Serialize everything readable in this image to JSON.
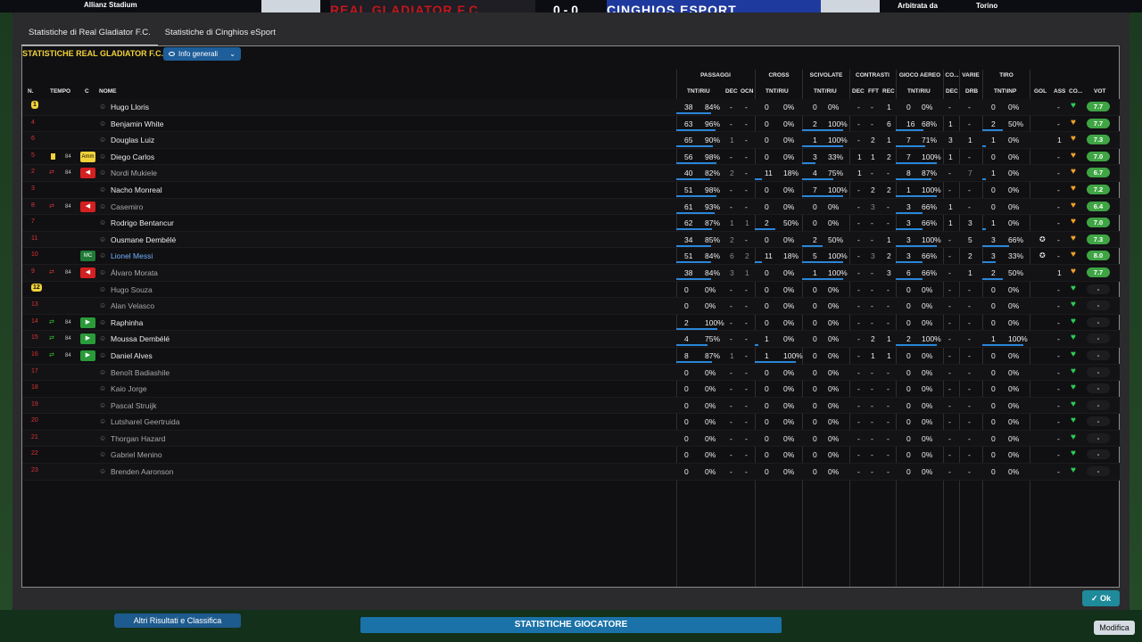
{
  "background": {
    "stadium": "Allianz Stadium",
    "referee_label": "Arbitrata da",
    "city": "Torino",
    "home_team": "REAL GLADIATOR F.C.",
    "away_team": "CINGHIOS ESPORT",
    "score": "0 - 0",
    "bottom_left_button": "Altri Risultati e Classifica",
    "bottom_mid_button": "STATISTICHE GIOCATORE",
    "bottom_right_button": "Modifica"
  },
  "tabs": [
    {
      "label": "Statistiche di Real Gladiator F.C."
    },
    {
      "label": "Statistiche di Cinghios eSport"
    }
  ],
  "panel": {
    "title": "STATISTICHE REAL GLADIATOR F.C.",
    "dropdown": "Info generali",
    "groups": {
      "passaggi": "PASSAGGI",
      "cross": "CROSS",
      "scivolate": "SCIVOLATE",
      "contrasti": "CONTRASTI",
      "gioco_aereo": "GIOCO AEREO",
      "co": "CO...",
      "varie": "VARIE",
      "tiro": "TIRO"
    },
    "columns": {
      "n": "N.",
      "tempo": "TEMPO",
      "c": "C",
      "nome": "NOME",
      "pass_tr": "TNT/RIU",
      "pass_dec": "DEC",
      "pass_ocn": "OCN",
      "cross_tr": "TNT/RIU",
      "sciv_tr": "TNT/RIU",
      "con_dec": "DEC",
      "con_fft": "FFT",
      "con_rec": "REC",
      "aereo_tr": "TNT/RIU",
      "co_dec": "DEC",
      "var_drb": "DRB",
      "tiro_ti": "TNT\\INP",
      "gol": "GOL",
      "ass": "ASS",
      "co2": "CO...",
      "vot": "VOT"
    }
  },
  "players": [
    {
      "n": "1",
      "tempo": "",
      "mins": "",
      "c": "",
      "name": "Hugo Lloris",
      "pass": [
        38,
        "84%"
      ],
      "dec": "-",
      "ocn": "-",
      "cross": [
        0,
        "0%"
      ],
      "sciv": [
        0,
        "0%"
      ],
      "cdec": "-",
      "fft": "-",
      "rec": "1",
      "aereo": [
        0,
        "0%"
      ],
      "codec": "-",
      "drb": "-",
      "tiro": [
        0,
        "0%"
      ],
      "gol": "",
      "ass": "-",
      "heart": "green",
      "vot": "7.7"
    },
    {
      "n": "4",
      "tempo": "",
      "mins": "",
      "c": "",
      "name": "Benjamin White",
      "pass": [
        63,
        "96%"
      ],
      "dec": "-",
      "ocn": "-",
      "cross": [
        0,
        "0%"
      ],
      "sciv": [
        2,
        "100%"
      ],
      "cdec": "-",
      "fft": "-",
      "rec": "6",
      "aereo": [
        16,
        "68%"
      ],
      "codec": "1",
      "drb": "-",
      "tiro": [
        2,
        "50%"
      ],
      "gol": "",
      "ass": "-",
      "heart": "orange",
      "vot": "7.7"
    },
    {
      "n": "6",
      "tempo": "",
      "mins": "",
      "c": "",
      "name": "Douglas Luiz",
      "pass": [
        65,
        "90%"
      ],
      "dec": "1",
      "ocn": "-",
      "cross": [
        0,
        "0%"
      ],
      "sciv": [
        1,
        "100%"
      ],
      "cdec": "-",
      "fft": "2",
      "rec": "1",
      "aereo": [
        7,
        "71%"
      ],
      "codec": "3",
      "drb": "1",
      "tiro": [
        1,
        "0%"
      ],
      "gol": "",
      "ass": "1",
      "heart": "orange",
      "vot": "7.3"
    },
    {
      "n": "5",
      "tempo": "card",
      "mins": "84",
      "c": "Amm",
      "name": "Diego Carlos",
      "pass": [
        56,
        "98%"
      ],
      "dec": "-",
      "ocn": "-",
      "cross": [
        0,
        "0%"
      ],
      "sciv": [
        3,
        "33%"
      ],
      "cdec": "1",
      "fft": "1",
      "rec": "2",
      "aereo": [
        7,
        "100%"
      ],
      "codec": "1",
      "drb": "-",
      "tiro": [
        0,
        "0%"
      ],
      "gol": "",
      "ass": "-",
      "heart": "orange",
      "vot": "7.0"
    },
    {
      "n": "2",
      "tempo": "out",
      "mins": "84",
      "c": "sub-out",
      "name": "Nordi Mukiele",
      "pass": [
        40,
        "82%"
      ],
      "dec": "2",
      "ocn": "-",
      "cross": [
        11,
        "18%"
      ],
      "sciv": [
        4,
        "75%"
      ],
      "cdec": "1",
      "fft": "-",
      "rec": "-",
      "aereo": [
        8,
        "87%"
      ],
      "codec": "-",
      "drb": "7",
      "tiro": [
        1,
        "0%"
      ],
      "gol": "",
      "ass": "-",
      "heart": "orange",
      "vot": "6.7"
    },
    {
      "n": "3",
      "tempo": "",
      "mins": "",
      "c": "",
      "name": "Nacho Monreal",
      "pass": [
        51,
        "98%"
      ],
      "dec": "-",
      "ocn": "-",
      "cross": [
        0,
        "0%"
      ],
      "sciv": [
        7,
        "100%"
      ],
      "cdec": "-",
      "fft": "2",
      "rec": "2",
      "aereo": [
        1,
        "100%"
      ],
      "codec": "-",
      "drb": "-",
      "tiro": [
        0,
        "0%"
      ],
      "gol": "",
      "ass": "-",
      "heart": "orange",
      "vot": "7.2"
    },
    {
      "n": "8",
      "tempo": "out",
      "mins": "84",
      "c": "sub-out",
      "name": "Casemiro",
      "pass": [
        61,
        "93%"
      ],
      "dec": "-",
      "ocn": "-",
      "cross": [
        0,
        "0%"
      ],
      "sciv": [
        0,
        "0%"
      ],
      "cdec": "-",
      "fft": "3",
      "rec": "-",
      "aereo": [
        3,
        "66%"
      ],
      "codec": "1",
      "drb": "-",
      "tiro": [
        0,
        "0%"
      ],
      "gol": "",
      "ass": "-",
      "heart": "orange",
      "vot": "6.4"
    },
    {
      "n": "7",
      "tempo": "",
      "mins": "",
      "c": "",
      "name": "Rodrigo Bentancur",
      "pass": [
        62,
        "87%"
      ],
      "dec": "1",
      "ocn": "1",
      "cross": [
        2,
        "50%"
      ],
      "sciv": [
        0,
        "0%"
      ],
      "cdec": "-",
      "fft": "-",
      "rec": "-",
      "aereo": [
        3,
        "66%"
      ],
      "codec": "1",
      "drb": "3",
      "tiro": [
        1,
        "0%"
      ],
      "gol": "",
      "ass": "-",
      "heart": "orange",
      "vot": "7.0"
    },
    {
      "n": "11",
      "tempo": "",
      "mins": "",
      "c": "",
      "name": "Ousmane Dembélé",
      "pass": [
        34,
        "85%"
      ],
      "dec": "2",
      "ocn": "-",
      "cross": [
        0,
        "0%"
      ],
      "sciv": [
        2,
        "50%"
      ],
      "cdec": "-",
      "fft": "-",
      "rec": "1",
      "aereo": [
        3,
        "100%"
      ],
      "codec": "-",
      "drb": "5",
      "tiro": [
        3,
        "66%"
      ],
      "gol": "ball",
      "ass": "-",
      "heart": "orange",
      "vot": "7.3"
    },
    {
      "n": "10",
      "tempo": "",
      "mins": "",
      "c": "MC",
      "name": "Lionel Messi",
      "pass": [
        51,
        "84%"
      ],
      "dec": "6",
      "ocn": "2",
      "cross": [
        11,
        "18%"
      ],
      "sciv": [
        5,
        "100%"
      ],
      "cdec": "-",
      "fft": "3",
      "rec": "2",
      "aereo": [
        3,
        "66%"
      ],
      "codec": "-",
      "drb": "2",
      "tiro": [
        3,
        "33%"
      ],
      "gol": "ball",
      "ass": "-",
      "heart": "orange",
      "vot": "8.0"
    },
    {
      "n": "9",
      "tempo": "out",
      "mins": "84",
      "c": "sub-out",
      "name": "Álvaro Morata",
      "pass": [
        38,
        "84%"
      ],
      "dec": "3",
      "ocn": "1",
      "cross": [
        0,
        "0%"
      ],
      "sciv": [
        1,
        "100%"
      ],
      "cdec": "-",
      "fft": "-",
      "rec": "3",
      "aereo": [
        6,
        "66%"
      ],
      "codec": "-",
      "drb": "1",
      "tiro": [
        2,
        "50%"
      ],
      "gol": "",
      "ass": "1",
      "heart": "orange",
      "vot": "7.7"
    },
    {
      "n": "12",
      "tempo": "",
      "mins": "",
      "c": "",
      "name": "Hugo Souza",
      "pass": [
        0,
        "0%"
      ],
      "dec": "-",
      "ocn": "-",
      "cross": [
        0,
        "0%"
      ],
      "sciv": [
        0,
        "0%"
      ],
      "cdec": "-",
      "fft": "-",
      "rec": "-",
      "aereo": [
        0,
        "0%"
      ],
      "codec": "-",
      "drb": "-",
      "tiro": [
        0,
        "0%"
      ],
      "gol": "",
      "ass": "-",
      "heart": "green",
      "vot": "-"
    },
    {
      "n": "13",
      "tempo": "",
      "mins": "",
      "c": "",
      "name": "Alan Velasco",
      "pass": [
        0,
        "0%"
      ],
      "dec": "-",
      "ocn": "-",
      "cross": [
        0,
        "0%"
      ],
      "sciv": [
        0,
        "0%"
      ],
      "cdec": "-",
      "fft": "-",
      "rec": "-",
      "aereo": [
        0,
        "0%"
      ],
      "codec": "-",
      "drb": "-",
      "tiro": [
        0,
        "0%"
      ],
      "gol": "",
      "ass": "-",
      "heart": "green",
      "vot": "-"
    },
    {
      "n": "14",
      "tempo": "in",
      "mins": "84",
      "c": "sub-in",
      "name": "Raphinha",
      "pass": [
        2,
        "100%"
      ],
      "dec": "-",
      "ocn": "-",
      "cross": [
        0,
        "0%"
      ],
      "sciv": [
        0,
        "0%"
      ],
      "cdec": "-",
      "fft": "-",
      "rec": "-",
      "aereo": [
        0,
        "0%"
      ],
      "codec": "-",
      "drb": "-",
      "tiro": [
        0,
        "0%"
      ],
      "gol": "",
      "ass": "-",
      "heart": "green",
      "vot": "-"
    },
    {
      "n": "15",
      "tempo": "in",
      "mins": "84",
      "c": "sub-in",
      "name": "Moussa Dembélé",
      "pass": [
        4,
        "75%"
      ],
      "dec": "-",
      "ocn": "-",
      "cross": [
        1,
        "0%"
      ],
      "sciv": [
        0,
        "0%"
      ],
      "cdec": "-",
      "fft": "2",
      "rec": "1",
      "aereo": [
        2,
        "100%"
      ],
      "codec": "-",
      "drb": "-",
      "tiro": [
        1,
        "100%"
      ],
      "gol": "",
      "ass": "-",
      "heart": "green",
      "vot": "-"
    },
    {
      "n": "16",
      "tempo": "in",
      "mins": "84",
      "c": "sub-in",
      "name": "Daniel Alves",
      "pass": [
        8,
        "87%"
      ],
      "dec": "1",
      "ocn": "-",
      "cross": [
        1,
        "100%"
      ],
      "sciv": [
        0,
        "0%"
      ],
      "cdec": "-",
      "fft": "1",
      "rec": "1",
      "aereo": [
        0,
        "0%"
      ],
      "codec": "-",
      "drb": "-",
      "tiro": [
        0,
        "0%"
      ],
      "gol": "",
      "ass": "-",
      "heart": "green",
      "vot": "-"
    },
    {
      "n": "17",
      "tempo": "",
      "mins": "",
      "c": "",
      "name": "Benoît Badiashile",
      "pass": [
        0,
        "0%"
      ],
      "dec": "-",
      "ocn": "-",
      "cross": [
        0,
        "0%"
      ],
      "sciv": [
        0,
        "0%"
      ],
      "cdec": "-",
      "fft": "-",
      "rec": "-",
      "aereo": [
        0,
        "0%"
      ],
      "codec": "-",
      "drb": "-",
      "tiro": [
        0,
        "0%"
      ],
      "gol": "",
      "ass": "-",
      "heart": "green",
      "vot": "-"
    },
    {
      "n": "18",
      "tempo": "",
      "mins": "",
      "c": "",
      "name": "Kaio Jorge",
      "pass": [
        0,
        "0%"
      ],
      "dec": "-",
      "ocn": "-",
      "cross": [
        0,
        "0%"
      ],
      "sciv": [
        0,
        "0%"
      ],
      "cdec": "-",
      "fft": "-",
      "rec": "-",
      "aereo": [
        0,
        "0%"
      ],
      "codec": "-",
      "drb": "-",
      "tiro": [
        0,
        "0%"
      ],
      "gol": "",
      "ass": "-",
      "heart": "green",
      "vot": "-"
    },
    {
      "n": "19",
      "tempo": "",
      "mins": "",
      "c": "",
      "name": "Pascal Struijk",
      "pass": [
        0,
        "0%"
      ],
      "dec": "-",
      "ocn": "-",
      "cross": [
        0,
        "0%"
      ],
      "sciv": [
        0,
        "0%"
      ],
      "cdec": "-",
      "fft": "-",
      "rec": "-",
      "aereo": [
        0,
        "0%"
      ],
      "codec": "-",
      "drb": "-",
      "tiro": [
        0,
        "0%"
      ],
      "gol": "",
      "ass": "-",
      "heart": "green",
      "vot": "-"
    },
    {
      "n": "20",
      "tempo": "",
      "mins": "",
      "c": "",
      "name": "Lutsharel Geertruida",
      "pass": [
        0,
        "0%"
      ],
      "dec": "-",
      "ocn": "-",
      "cross": [
        0,
        "0%"
      ],
      "sciv": [
        0,
        "0%"
      ],
      "cdec": "-",
      "fft": "-",
      "rec": "-",
      "aereo": [
        0,
        "0%"
      ],
      "codec": "-",
      "drb": "-",
      "tiro": [
        0,
        "0%"
      ],
      "gol": "",
      "ass": "-",
      "heart": "green",
      "vot": "-"
    },
    {
      "n": "21",
      "tempo": "",
      "mins": "",
      "c": "",
      "name": "Thorgan Hazard",
      "pass": [
        0,
        "0%"
      ],
      "dec": "-",
      "ocn": "-",
      "cross": [
        0,
        "0%"
      ],
      "sciv": [
        0,
        "0%"
      ],
      "cdec": "-",
      "fft": "-",
      "rec": "-",
      "aereo": [
        0,
        "0%"
      ],
      "codec": "-",
      "drb": "-",
      "tiro": [
        0,
        "0%"
      ],
      "gol": "",
      "ass": "-",
      "heart": "green",
      "vot": "-"
    },
    {
      "n": "22",
      "tempo": "",
      "mins": "",
      "c": "",
      "name": "Gabriel Menino",
      "pass": [
        0,
        "0%"
      ],
      "dec": "-",
      "ocn": "-",
      "cross": [
        0,
        "0%"
      ],
      "sciv": [
        0,
        "0%"
      ],
      "cdec": "-",
      "fft": "-",
      "rec": "-",
      "aereo": [
        0,
        "0%"
      ],
      "codec": "-",
      "drb": "-",
      "tiro": [
        0,
        "0%"
      ],
      "gol": "",
      "ass": "-",
      "heart": "green",
      "vot": "-"
    },
    {
      "n": "23",
      "tempo": "",
      "mins": "",
      "c": "",
      "name": "Brenden Aaronson",
      "pass": [
        0,
        "0%"
      ],
      "dec": "-",
      "ocn": "-",
      "cross": [
        0,
        "0%"
      ],
      "sciv": [
        0,
        "0%"
      ],
      "cdec": "-",
      "fft": "-",
      "rec": "-",
      "aereo": [
        0,
        "0%"
      ],
      "codec": "-",
      "drb": "-",
      "tiro": [
        0,
        "0%"
      ],
      "gol": "",
      "ass": "-",
      "heart": "green",
      "vot": "-"
    }
  ],
  "ok_button": "Ok",
  "colors": {
    "accent_yellow": "#f2d23a",
    "button_blue": "#1e5e9a",
    "rating_green": "#3fa544",
    "bar_blue": "#2a86d8"
  }
}
